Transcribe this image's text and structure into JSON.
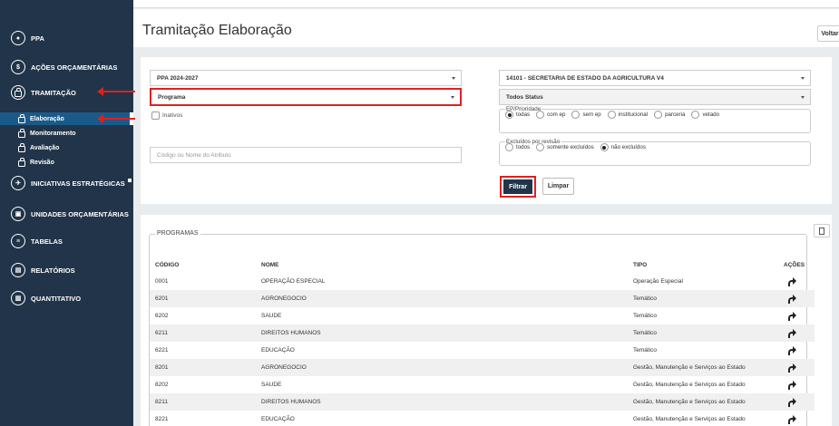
{
  "sidebar": {
    "items": [
      {
        "icon": "ppa-icon",
        "glyph": "●",
        "label": "PPA"
      },
      {
        "icon": "dollar-icon",
        "glyph": "$",
        "label": "AÇÕES ORÇAMENTÁRIAS"
      },
      {
        "icon": "lock-icon",
        "glyph": "🔒",
        "label": "TRAMITAÇÃO"
      },
      {
        "icon": "rocket-icon",
        "glyph": "✈",
        "label": "INICIATIVAS ESTRATÉGICAS"
      },
      {
        "icon": "bank-icon",
        "glyph": "▣",
        "label": "UNIDADES ORÇAMENTÁRIAS"
      },
      {
        "icon": "list-icon",
        "glyph": "≡",
        "label": "TABELAS"
      },
      {
        "icon": "file-icon",
        "glyph": "▤",
        "label": "RELATÓRIOS"
      },
      {
        "icon": "chart-icon",
        "glyph": "▥",
        "label": "QUANTITATIVO"
      }
    ],
    "submenu": [
      {
        "label": "Elaboração",
        "active": true
      },
      {
        "label": "Monitoramento",
        "active": false
      },
      {
        "label": "Avaliação",
        "active": false
      },
      {
        "label": "Revisão",
        "active": false
      }
    ]
  },
  "header": {
    "title": "Tramitação Elaboração",
    "back_label": "Voltar"
  },
  "filters": {
    "ppa_select": "PPA 2024-2027",
    "programa_select": "Programa",
    "inativos_label": "Inativos",
    "attr_placeholder": "Código ou Nome do Atributo",
    "secretaria_select": "14101 - SECRETARIA DE ESTADO DA AGRICULTURA V4",
    "status_select": "Todos Status",
    "ep_legend": "EP/Prioridade",
    "ep_options": [
      {
        "label": "todas",
        "checked": true
      },
      {
        "label": "com ep",
        "checked": false
      },
      {
        "label": "sem ep",
        "checked": false
      },
      {
        "label": "institucional",
        "checked": false
      },
      {
        "label": "parceria",
        "checked": false
      },
      {
        "label": "vetado",
        "checked": false
      }
    ],
    "excl_legend": "Excluídos por revisão",
    "excl_options": [
      {
        "label": "todos",
        "checked": false
      },
      {
        "label": "somente excluídos",
        "checked": false
      },
      {
        "label": "não excluídos",
        "checked": true
      }
    ],
    "filter_button": "Filtrar",
    "clear_button": "Limpar"
  },
  "results": {
    "legend": "PROGRAMAS",
    "columns": [
      "CÓDIGO",
      "NOME",
      "TIPO",
      "AÇÕES"
    ],
    "rows": [
      {
        "codigo": "0001",
        "nome": "OPERAÇÃO ESPECIAL",
        "tipo": "Operação Especial"
      },
      {
        "codigo": "6201",
        "nome": "AGRONEGOCIO",
        "tipo": "Temático"
      },
      {
        "codigo": "6202",
        "nome": "SAUDE",
        "tipo": "Temático"
      },
      {
        "codigo": "6211",
        "nome": "DIREITOS HUMANOS",
        "tipo": "Temático"
      },
      {
        "codigo": "6221",
        "nome": "EDUCAÇÃO",
        "tipo": "Temático"
      },
      {
        "codigo": "8201",
        "nome": "AGRONEGOCIO",
        "tipo": "Gestão, Manutenção e Serviços ao Estado"
      },
      {
        "codigo": "8202",
        "nome": "SAUDE",
        "tipo": "Gestão, Manutenção e Serviços ao Estado"
      },
      {
        "codigo": "8211",
        "nome": "DIREITOS HUMANOS",
        "tipo": "Gestão, Manutenção e Serviços ao Estado"
      },
      {
        "codigo": "8221",
        "nome": "EDUCAÇÃO",
        "tipo": "Gestão, Manutenção e Serviços ao Estado"
      }
    ]
  },
  "colors": {
    "sidebar_bg": "#213449",
    "active_sub_bg": "#1a5a8a",
    "highlight_red": "#e02020",
    "primary_button": "#213449"
  }
}
